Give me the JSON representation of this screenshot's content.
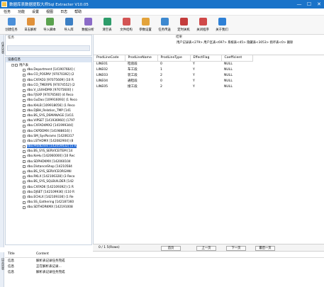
{
  "window": {
    "title": "数据库表数据提取大师Sql Extracter V10.05",
    "min": "—",
    "max": "☐",
    "close": "✕"
  },
  "menu": [
    "任务",
    "功能",
    "设置",
    "视图",
    "日志",
    "帮助"
  ],
  "toolbar": [
    {
      "label": "创建任务",
      "icon": "new-task-icon",
      "color": "#4a8fd9"
    },
    {
      "label": "日志解析",
      "icon": "log-parse-icon",
      "color": "#e0913a"
    },
    {
      "label": "导入脚本",
      "icon": "import-script-icon",
      "color": "#5aa24f"
    },
    {
      "label": "导入库",
      "icon": "import-db-icon",
      "color": "#3b7fc4"
    },
    {
      "label": "数据分析",
      "icon": "analyze-icon",
      "color": "#8b6bc7"
    },
    {
      "label": "清空表",
      "icon": "clear-table-icon",
      "color": "#2d9c6a"
    },
    {
      "label": "文件结构",
      "icon": "file-structure-icon",
      "color": "#d35454"
    },
    {
      "label": "参数设置",
      "icon": "settings-icon",
      "color": "#e3a33b"
    },
    {
      "label": "任务传送",
      "icon": "task-transfer-icon",
      "color": "#3d89d0"
    },
    {
      "label": "定时关机",
      "icon": "shutdown-timer-icon",
      "color": "#c43c3c"
    },
    {
      "label": "关闭程序",
      "icon": "close-program-icon",
      "color": "#d04848"
    },
    {
      "label": "关于我们",
      "icon": "about-icon",
      "color": "#2e80d6"
    }
  ],
  "left_tabs": {
    "task": "任务列表",
    "log": "日志列表"
  },
  "task_panel": {
    "header": "任务"
  },
  "tree": {
    "header": "设备信息",
    "root": "用户表",
    "selected_index": 19,
    "items": [
      "dbo.Department [141907664] (",
      "dbo.CO_POSPAY [97070392] (2",
      "dbo.CXFAD3 [97075609] (10 R",
      "dbo.CO_TMERPS [97074552] (2",
      "dbo.V_LSXHDMX [97075600] (",
      "dbo.FJSXP [97076560] (4 Reco",
      "dbo.GuDao [109916093] (1 Reco",
      "dbo.KHLB [109918056] (1 Reco",
      "dbo.DJBH_Relation_TMP [141",
      "dbo.BS_SYS_DSMANAGE [1411",
      "dbo.VIPSET [141936960] (1797",
      "dbo.CXFAD4MX2 [141999344]",
      "dbo.CKPDDMX [141988616] (",
      "dbo.SM_SysParams [14206317",
      "dbo.LSTHDMX [142082904] (8",
      "dbo.ProdLines [142059432] (5 R",
      "dbo.BS_SYS_SERVICEITEM [14",
      "dbo.KeHu [142060000] (10 Rec",
      "dbo.SDPHDKMX [142060104 ",
      "dbo.DistanceShop [14210584",
      "dbo.BS_SYS_SERVICEORGANI",
      "dbo.RKLX [142106328] (3 Reco",
      "dbo.BS_SYS_SQLBUILDER [142",
      "dbo.CXFAD6 [142109392] (1 R",
      "dbo.DJSET [142109936] (110 R",
      "dbo.ECHLX [142109336] (1 Re",
      "dbo.SS_Gathering [142187360",
      "dbo.SDTHDRKMX [142191008"
    ]
  },
  "results": {
    "header": "结果",
    "stats": "用户记录表<279> 用户区表<697> 系统表<45> 隐藏表<3053> 损坏表<0> 删除",
    "columns": [
      "ProdLineCode",
      "ProdLineName",
      "ProdLineType",
      "EffectFlag",
      "Coefficient"
    ],
    "rows": [
      [
        "LINE01",
        "检验段",
        "0",
        "Y",
        "NULL"
      ],
      [
        "LINE02",
        "车工段",
        "1",
        "Y",
        "NULL"
      ],
      [
        "LINE03",
        "装工段",
        "2",
        "Y",
        "NULL"
      ],
      [
        "LINE04",
        "通检段",
        "0",
        "Y",
        "NULL"
      ],
      [
        "LINE05",
        "接工段",
        "2",
        "Y",
        "NULL"
      ]
    ]
  },
  "pager": {
    "info": "0 / 1  5(Rows)",
    "first": "首页",
    "prev": "上一页",
    "next": "下一页",
    "last": "最后一页"
  },
  "log": {
    "columns": [
      "Title",
      "Content"
    ],
    "rows": [
      [
        "信息",
        "解析表记录任务完成"
      ],
      [
        "信息",
        "正在解析表记录..."
      ],
      [
        "信息",
        "解析表记录任务完成"
      ]
    ]
  }
}
